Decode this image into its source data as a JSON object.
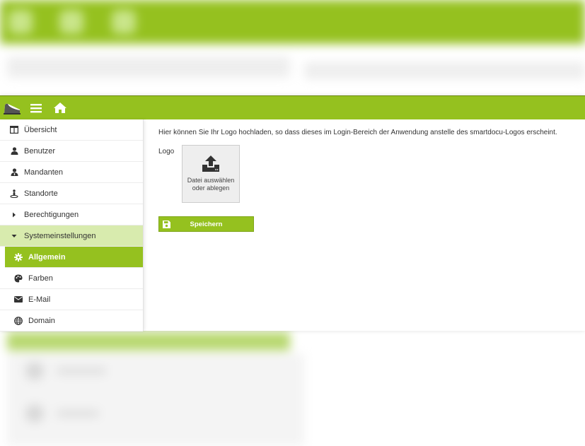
{
  "brand": {
    "accent": "#95c11f",
    "accent_light": "#d8ebae",
    "text": "#333333"
  },
  "toolbar": {
    "menu_icon": "hamburger-icon",
    "home_icon": "home-icon"
  },
  "sidebar": {
    "items": [
      {
        "label": "Übersicht",
        "icon": "table-icon"
      },
      {
        "label": "Benutzer",
        "icon": "user-icon"
      },
      {
        "label": "Mandanten",
        "icon": "user-tie-icon"
      },
      {
        "label": "Standorte",
        "icon": "map-marker-person-icon"
      },
      {
        "label": "Berechtigungen",
        "icon": "caret-right-icon"
      },
      {
        "label": "Systemeinstellungen",
        "icon": "caret-down-icon"
      }
    ],
    "sub_items": [
      {
        "label": "Allgemein",
        "icon": "gear-icon"
      },
      {
        "label": "Farben",
        "icon": "palette-icon"
      },
      {
        "label": "E-Mail",
        "icon": "envelope-icon"
      },
      {
        "label": "Domain",
        "icon": "globe-icon"
      }
    ]
  },
  "main": {
    "intro_text": "Hier können Sie Ihr Logo hochladen, so dass dieses im Login-Bereich der Anwendung anstelle des smartdocu-Logos erscheint.",
    "logo_label": "Logo",
    "dropzone_line1": "Datei auswählen",
    "dropzone_line2": "oder ablegen",
    "save_label": "Speichern"
  }
}
